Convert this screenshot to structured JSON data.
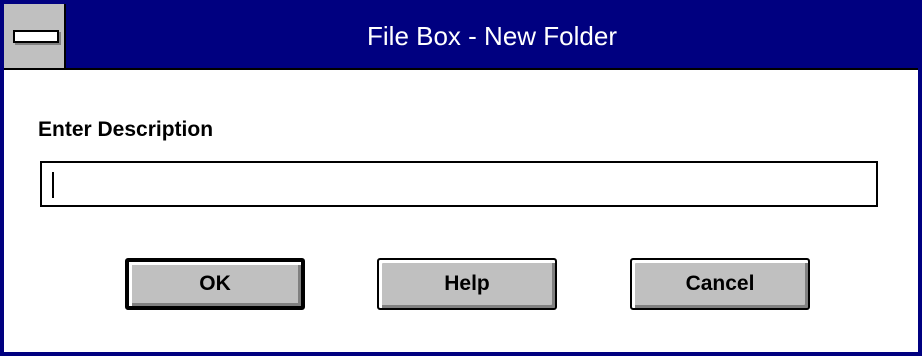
{
  "window": {
    "title": "File Box - New Folder"
  },
  "form": {
    "label": "Enter Description",
    "input_value": ""
  },
  "buttons": {
    "ok": "OK",
    "help": "Help",
    "cancel": "Cancel"
  },
  "colors": {
    "titlebar": "#000080",
    "button_face": "#c0c0c0",
    "background": "#ffffff"
  },
  "icons": {
    "system_menu": "system-menu-icon"
  }
}
